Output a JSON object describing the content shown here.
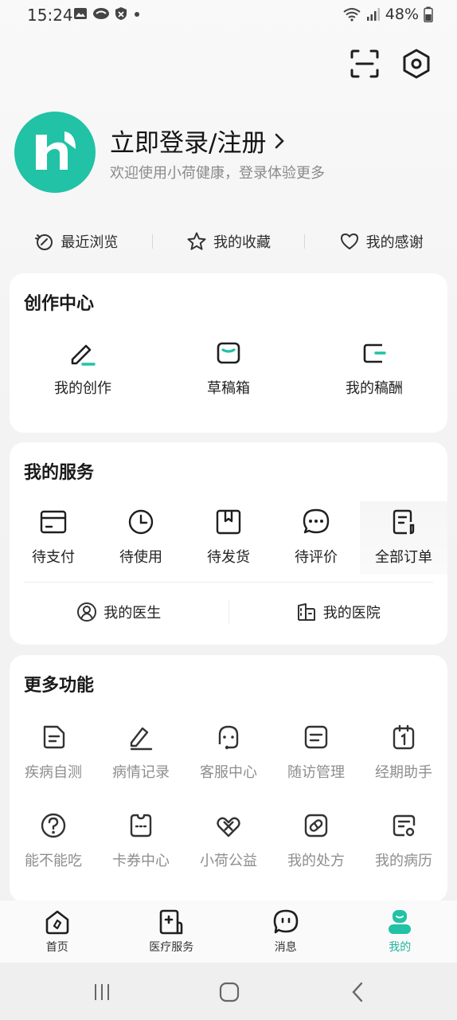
{
  "status": {
    "time": "15:24",
    "battery": "48%"
  },
  "profile": {
    "login_label": "立即登录/注册",
    "subtitle": "欢迎使用小荷健康，登录体验更多"
  },
  "quick_links": [
    {
      "label": "最近浏览",
      "icon": "history-icon"
    },
    {
      "label": "我的收藏",
      "icon": "star-icon"
    },
    {
      "label": "我的感谢",
      "icon": "heart-icon"
    }
  ],
  "creation": {
    "title": "创作中心",
    "items": [
      {
        "label": "我的创作",
        "icon": "pen-icon"
      },
      {
        "label": "草稿箱",
        "icon": "draft-box-icon"
      },
      {
        "label": "我的稿酬",
        "icon": "wallet-icon"
      }
    ]
  },
  "services": {
    "title": "我的服务",
    "items": [
      {
        "label": "待支付",
        "icon": "card-icon"
      },
      {
        "label": "待使用",
        "icon": "clock-icon"
      },
      {
        "label": "待发货",
        "icon": "bookmark-icon"
      },
      {
        "label": "待评价",
        "icon": "chat-dots-icon"
      },
      {
        "label": "全部订单",
        "icon": "orders-icon"
      }
    ],
    "doctor": "我的医生",
    "hospital": "我的医院"
  },
  "more": {
    "title": "更多功能",
    "row1": [
      {
        "label": "疾病自测",
        "icon": "self-test-icon"
      },
      {
        "label": "病情记录",
        "icon": "record-icon"
      },
      {
        "label": "客服中心",
        "icon": "customer-service-icon"
      },
      {
        "label": "随访管理",
        "icon": "follow-up-icon"
      },
      {
        "label": "经期助手",
        "icon": "calendar-icon"
      }
    ],
    "row2": [
      {
        "label": "能不能吃",
        "icon": "question-icon"
      },
      {
        "label": "卡券中心",
        "icon": "coupon-icon"
      },
      {
        "label": "小荷公益",
        "icon": "charity-icon"
      },
      {
        "label": "我的处方",
        "icon": "pill-icon"
      },
      {
        "label": "我的病历",
        "icon": "medical-record-icon"
      }
    ]
  },
  "tabs": [
    {
      "label": "首页",
      "icon": "home-icon"
    },
    {
      "label": "医疗服务",
      "icon": "medical-service-icon"
    },
    {
      "label": "消息",
      "icon": "message-icon"
    },
    {
      "label": "我的",
      "icon": "profile-icon",
      "active": true
    }
  ],
  "colors": {
    "accent": "#21c2a6",
    "active_tab": "#21b59c"
  }
}
